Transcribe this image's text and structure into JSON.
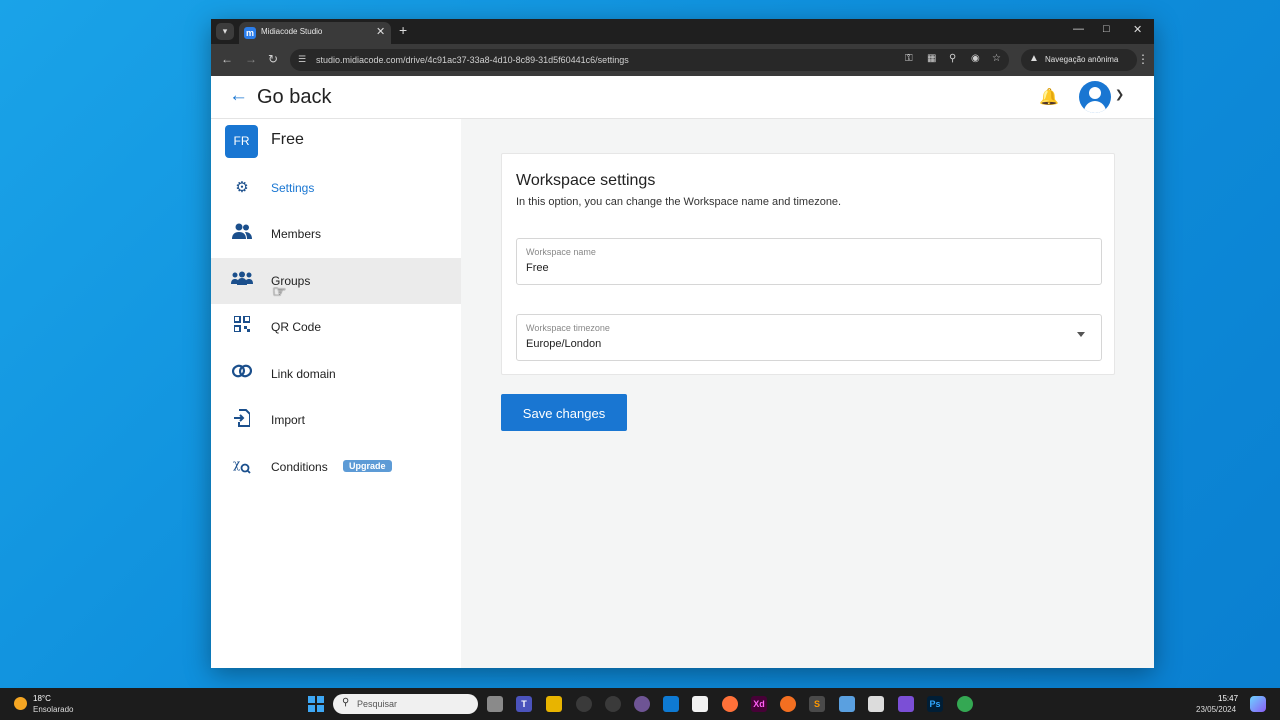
{
  "browser": {
    "tab_title": "Midiacode Studio",
    "favicon_letter": "m",
    "url": "studio.midiacode.com/drive/4c91ac37-33a8-4d10-8c89-31d5f60441c6/settings",
    "incognito_label": "Navegação anônima"
  },
  "header": {
    "back_label": "Go back"
  },
  "sidebar": {
    "workspace_initials": "FR",
    "workspace_name": "Free",
    "items": [
      {
        "label": "Settings",
        "icon": "gear-icon",
        "active": true
      },
      {
        "label": "Members",
        "icon": "people-icon"
      },
      {
        "label": "Groups",
        "icon": "groups-icon",
        "hovered": true
      },
      {
        "label": "QR Code",
        "icon": "qr-code-icon"
      },
      {
        "label": "Link domain",
        "icon": "link-icon"
      },
      {
        "label": "Import",
        "icon": "import-icon"
      },
      {
        "label": "Conditions",
        "icon": "conditions-icon",
        "badge": "Upgrade"
      }
    ]
  },
  "settings": {
    "title": "Workspace settings",
    "description": "In this option, you can change the Workspace name and timezone.",
    "name_label": "Workspace name",
    "name_value": "Free",
    "timezone_label": "Workspace timezone",
    "timezone_value": "Europe/London",
    "save_label": "Save changes"
  },
  "taskbar": {
    "weather_temp": "18°C",
    "weather_condition": "Ensolarado",
    "search_placeholder": "Pesquisar",
    "time": "15:47",
    "date": "23/05/2024"
  },
  "colors": {
    "accent": "#1976d2",
    "nav_icon": "#1b4f8c",
    "upgrade_badge": "#5d9bd6"
  }
}
